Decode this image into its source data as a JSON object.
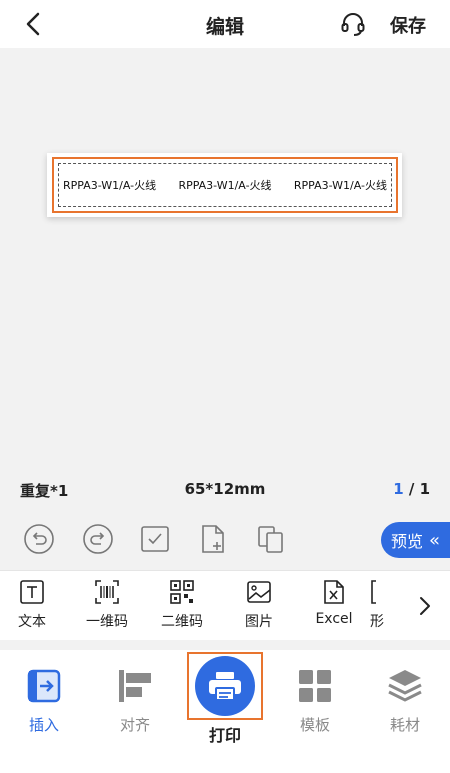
{
  "header": {
    "title": "编辑",
    "save_label": "保存"
  },
  "label": {
    "texts": [
      "RPPA3-W1/A-火线",
      "RPPA3-W1/A-火线",
      "RPPA3-W1/A-火线"
    ]
  },
  "info": {
    "repeat": "重复*1",
    "size": "65*12mm",
    "page_current": "1",
    "page_sep": " / ",
    "page_total": "1"
  },
  "toolbar": {
    "preview_label": "预览",
    "preview_chevron": "«"
  },
  "insert": {
    "items": [
      {
        "label": "文本",
        "icon": "text-icon"
      },
      {
        "label": "一维码",
        "icon": "barcode-icon"
      },
      {
        "label": "二维码",
        "icon": "qrcode-icon"
      },
      {
        "label": "图片",
        "icon": "image-icon"
      },
      {
        "label": "Excel",
        "icon": "excel-icon"
      },
      {
        "label": "形",
        "icon": "shape-icon"
      }
    ]
  },
  "nav": {
    "items": [
      {
        "label": "插入",
        "icon": "insert-icon",
        "active": true
      },
      {
        "label": "对齐",
        "icon": "align-icon"
      },
      {
        "label": "打印",
        "icon": "printer-icon"
      },
      {
        "label": "模板",
        "icon": "template-icon"
      },
      {
        "label": "耗材",
        "icon": "layers-icon"
      }
    ]
  },
  "colors": {
    "accent": "#2f6be0",
    "selection": "#e8742e",
    "canvas_bg": "#f2f2f2",
    "nav_inactive": "#8a8a8a"
  }
}
